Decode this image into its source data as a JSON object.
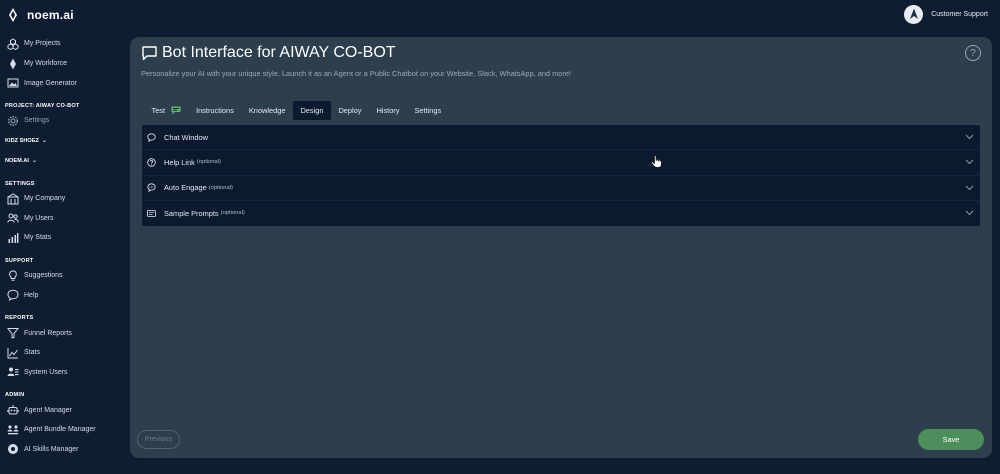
{
  "brand": {
    "name": "noem.ai"
  },
  "user": {
    "name": "Customer Support"
  },
  "sidebar": {
    "top_items": [
      {
        "label": "My Projects",
        "icon": "projects-icon"
      },
      {
        "label": "My Workforce",
        "icon": "workforce-icon"
      },
      {
        "label": "Image Generator",
        "icon": "image-icon"
      }
    ],
    "project_section": "PROJECT: AIWAY CO-BOT",
    "project_items": [
      {
        "label": "Settings",
        "icon": "gear-icon"
      }
    ],
    "toggles": [
      {
        "label": "KIDZ SHOEZ"
      },
      {
        "label": "NOEM.AI"
      }
    ],
    "settings_section": "SETTINGS",
    "settings_items": [
      {
        "label": "My Company",
        "icon": "company-icon"
      },
      {
        "label": "My Users",
        "icon": "users-icon"
      },
      {
        "label": "My Stats",
        "icon": "stats-icon"
      }
    ],
    "support_section": "SUPPORT",
    "support_items": [
      {
        "label": "Suggestions",
        "icon": "lightbulb-icon"
      },
      {
        "label": "Help",
        "icon": "chat-bubble-icon"
      }
    ],
    "reports_section": "REPORTS",
    "reports_items": [
      {
        "label": "Funnel Reports",
        "icon": "funnel-icon"
      },
      {
        "label": "Stats",
        "icon": "chart-icon"
      },
      {
        "label": "System Users",
        "icon": "system-users-icon"
      }
    ],
    "admin_section": "ADMIN",
    "admin_items": [
      {
        "label": "Agent Manager",
        "icon": "robot-icon"
      },
      {
        "label": "Agent Bundle Manager",
        "icon": "bundle-icon"
      },
      {
        "label": "AI Skills Manager",
        "icon": "skills-icon"
      }
    ]
  },
  "main": {
    "title": "Bot Interface for AIWAY CO-BOT",
    "subtitle": "Personalize your AI with your unique style. Launch it as an Agent or a Public Chatbot on your Website, Slack, WhatsApp, and more!",
    "help_symbol": "?",
    "tabs": [
      {
        "label": "Test"
      },
      {
        "label": "Instructions"
      },
      {
        "label": "Knowledge"
      },
      {
        "label": "Design"
      },
      {
        "label": "Deploy"
      },
      {
        "label": "History"
      },
      {
        "label": "Settings"
      }
    ],
    "active_tab": "Design",
    "sections": [
      {
        "label": "Chat Window",
        "optional": ""
      },
      {
        "label": "Help Link",
        "optional": "(optional)"
      },
      {
        "label": "Auto Engage",
        "optional": "(optional)"
      },
      {
        "label": "Sample Prompts",
        "optional": "(optional)"
      }
    ],
    "previous_label": "Previous",
    "save_label": "Save"
  },
  "colors": {
    "background": "#0f1d33",
    "panel": "#2d3e4d",
    "accordion": "#0b1a2f",
    "save_button": "#4d8f5a"
  }
}
